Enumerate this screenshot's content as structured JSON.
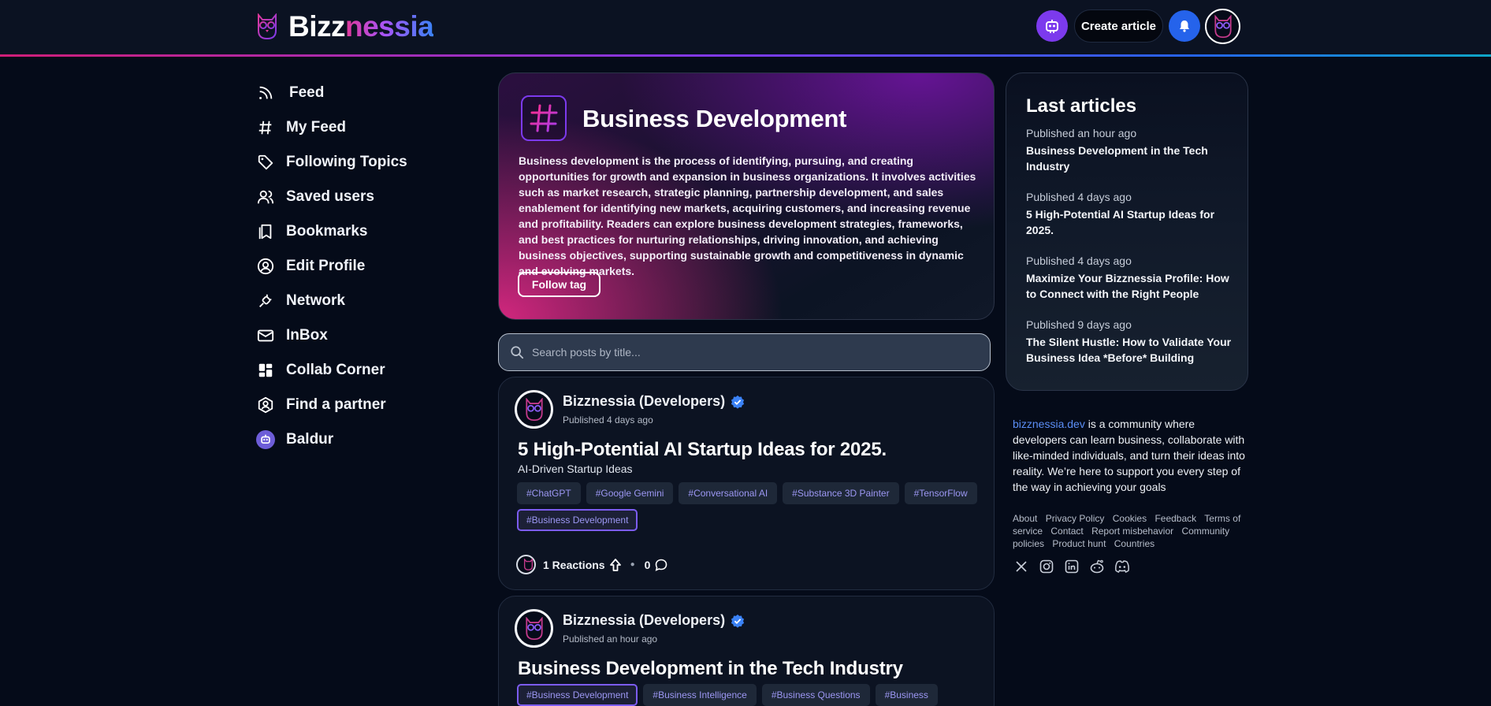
{
  "header": {
    "logo_part1": "Bizz",
    "logo_part2": "nessia",
    "create_label": "Create article"
  },
  "sidebar": {
    "items": [
      {
        "label": "Feed"
      },
      {
        "label": "My Feed"
      },
      {
        "label": "Following Topics"
      },
      {
        "label": "Saved users"
      },
      {
        "label": "Bookmarks"
      },
      {
        "label": "Edit Profile"
      },
      {
        "label": "Network"
      },
      {
        "label": "InBox"
      },
      {
        "label": "Collab Corner"
      },
      {
        "label": "Find a partner"
      },
      {
        "label": "Baldur"
      }
    ]
  },
  "hero": {
    "title": "Business Development",
    "description": "Business development is the process of identifying, pursuing, and creating opportunities for growth and expansion in business organizations. It involves activities such as market research, strategic planning, partnership development, and sales enablement for identifying new markets, acquiring customers, and increasing revenue and profitability. Readers can explore business development strategies, frameworks, and best practices for nurturing relationships, driving innovation, and achieving business objectives, supporting sustainable growth and competitiveness in dynamic and evolving markets.",
    "follow_label": "Follow tag"
  },
  "search": {
    "placeholder": "Search posts by title..."
  },
  "posts": [
    {
      "author": "Bizznessia (Developers)",
      "date": "Published 4 days ago",
      "title": "5 High-Potential AI Startup Ideas for 2025.",
      "subtitle": "AI-Driven Startup Ideas",
      "tags": [
        "#ChatGPT",
        "#Google Gemini",
        "#Conversational AI",
        "#Substance 3D Painter",
        "#TensorFlow",
        "#Business Development"
      ],
      "reactions": "1 Reactions",
      "comments": "0"
    },
    {
      "author": "Bizznessia (Developers)",
      "date": "Published an hour ago",
      "title": "Business Development in the Tech Industry",
      "tags": [
        "#Business Development",
        "#Business Intelligence",
        "#Business Questions",
        "#Business"
      ]
    }
  ],
  "last_articles": {
    "title": "Last articles",
    "items": [
      {
        "when": "Published an hour ago",
        "what": "Business Development in the Tech Industry"
      },
      {
        "when": "Published 4 days ago",
        "what": "5 High-Potential AI Startup Ideas for 2025."
      },
      {
        "when": "Published 4 days ago",
        "what": "Maximize Your Bizznessia Profile: How to Connect with the Right People"
      },
      {
        "when": "Published 9 days ago",
        "what": "The Silent Hustle: How to Validate Your Business Idea *Before* Building"
      }
    ]
  },
  "about": {
    "link": "bizznessia.dev",
    "text": " is a community where developers can learn business, collaborate with like-minded individuals, and turn their ideas into reality. We’re here to support you every step of the way in achieving your goals"
  },
  "footer": {
    "links": [
      "About",
      "Privacy Policy",
      "Cookies",
      "Feedback",
      "Terms of service",
      "Contact",
      "Report misbehavior",
      "Community policies",
      "Product hunt",
      "Countries"
    ]
  },
  "colors": {
    "accent_purple": "#7c3aed",
    "accent_blue": "#2563eb",
    "accent_pink": "#d11e78",
    "tag_text": "#9c97f3",
    "background": "#050b19"
  }
}
